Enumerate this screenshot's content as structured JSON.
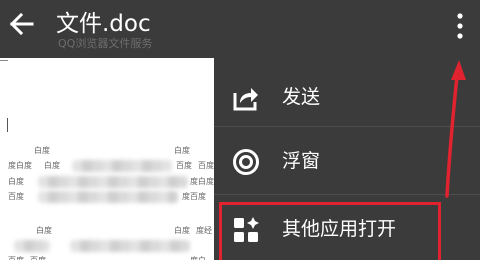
{
  "header": {
    "title": "文件.doc",
    "subtitle": "QQ浏览器文件服务"
  },
  "icons": {
    "back": "back-arrow-icon",
    "overflow": "overflow-menu-icon",
    "send": "share-icon",
    "float": "floating-window-icon",
    "other": "apps-grid-icon"
  },
  "colors": {
    "background": "#3b3b3b",
    "text": "#ffffff",
    "subtitle": "#6d6d6d",
    "annotation": "#e0232e"
  },
  "menu": {
    "items": [
      {
        "label": "发送"
      },
      {
        "label": "浮窗"
      },
      {
        "label": "其他应用打开"
      }
    ]
  },
  "document": {
    "visible_words": [
      "白度",
      "白度",
      "度白度",
      "白度",
      "百度",
      "百度",
      "白度",
      "度白度",
      "百度",
      "度百度",
      "白度",
      "白度",
      "度经",
      "百度",
      "百度",
      "度白"
    ]
  }
}
